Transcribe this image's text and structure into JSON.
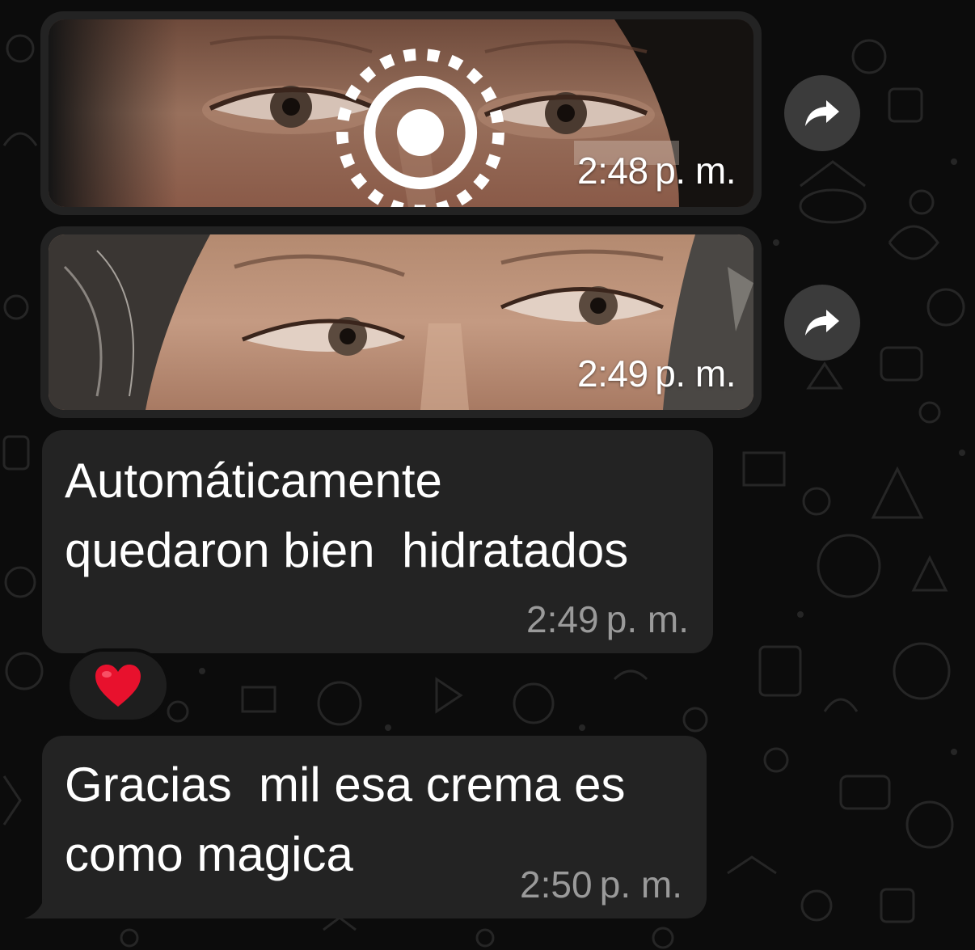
{
  "messages": [
    {
      "type": "image",
      "time": "2:48",
      "period": "p. m.",
      "view_once_icon": "view-once-icon"
    },
    {
      "type": "image",
      "time": "2:49",
      "period": "p. m."
    },
    {
      "type": "text",
      "lines": [
        "Automáticamente",
        "quedaron bien  hidratados"
      ],
      "time": "2:49",
      "period": "p. m.",
      "reaction": "❤️"
    },
    {
      "type": "text",
      "lines": [
        "Gracias  mil esa crema es",
        "como magica"
      ],
      "time": "2:50",
      "period": "p. m."
    }
  ],
  "icons": {
    "forward": "forward-arrow-icon",
    "view_once": "view-once-icon",
    "reaction": "red-heart-emoji"
  },
  "colors": {
    "background": "#0c0c0c",
    "bubble": "#232323",
    "forward_button": "#3b3b3b",
    "timestamp_text": "#9a9a9a",
    "heart": "#e8112d"
  }
}
